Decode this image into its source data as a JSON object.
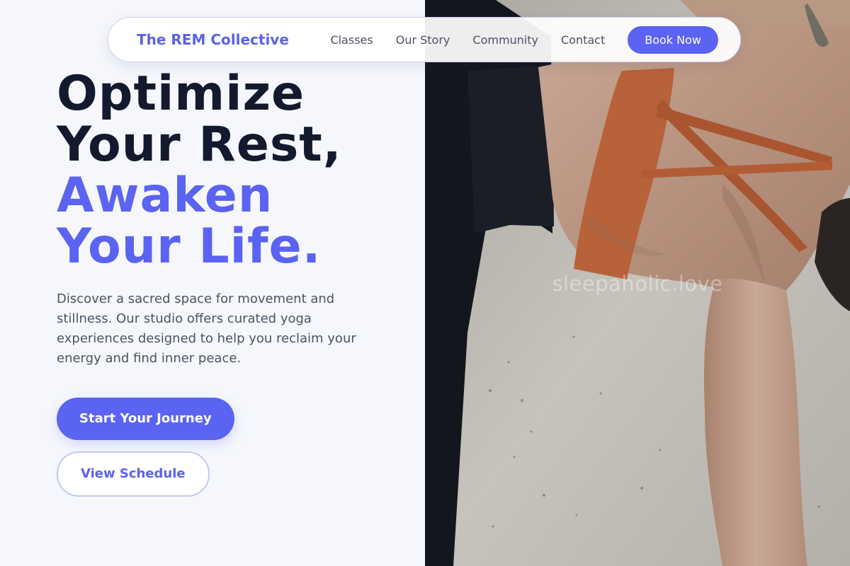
{
  "nav": {
    "brand": "The REM Collective",
    "links": [
      "Classes",
      "Our Story",
      "Community",
      "Contact"
    ],
    "cta": "Book Now"
  },
  "hero": {
    "title_lines": [
      "Optimize",
      "Your Rest,"
    ],
    "accent_lines": [
      "Awaken",
      "Your Life."
    ],
    "description": "Discover a sacred space for movement and stillness. Our studio offers curated yoga experiences designed to help you reclaim your energy and find inner peace.",
    "primary_button": "Start Your Journey",
    "secondary_button": "View Schedule"
  },
  "image": {
    "watermark": "sleepaholic.love",
    "subject": "yoga-pose-photo"
  },
  "colors": {
    "accent": "#5b63f2",
    "heading": "#141a2e",
    "body_text": "#4c5366",
    "background": "#f5f7fc"
  }
}
